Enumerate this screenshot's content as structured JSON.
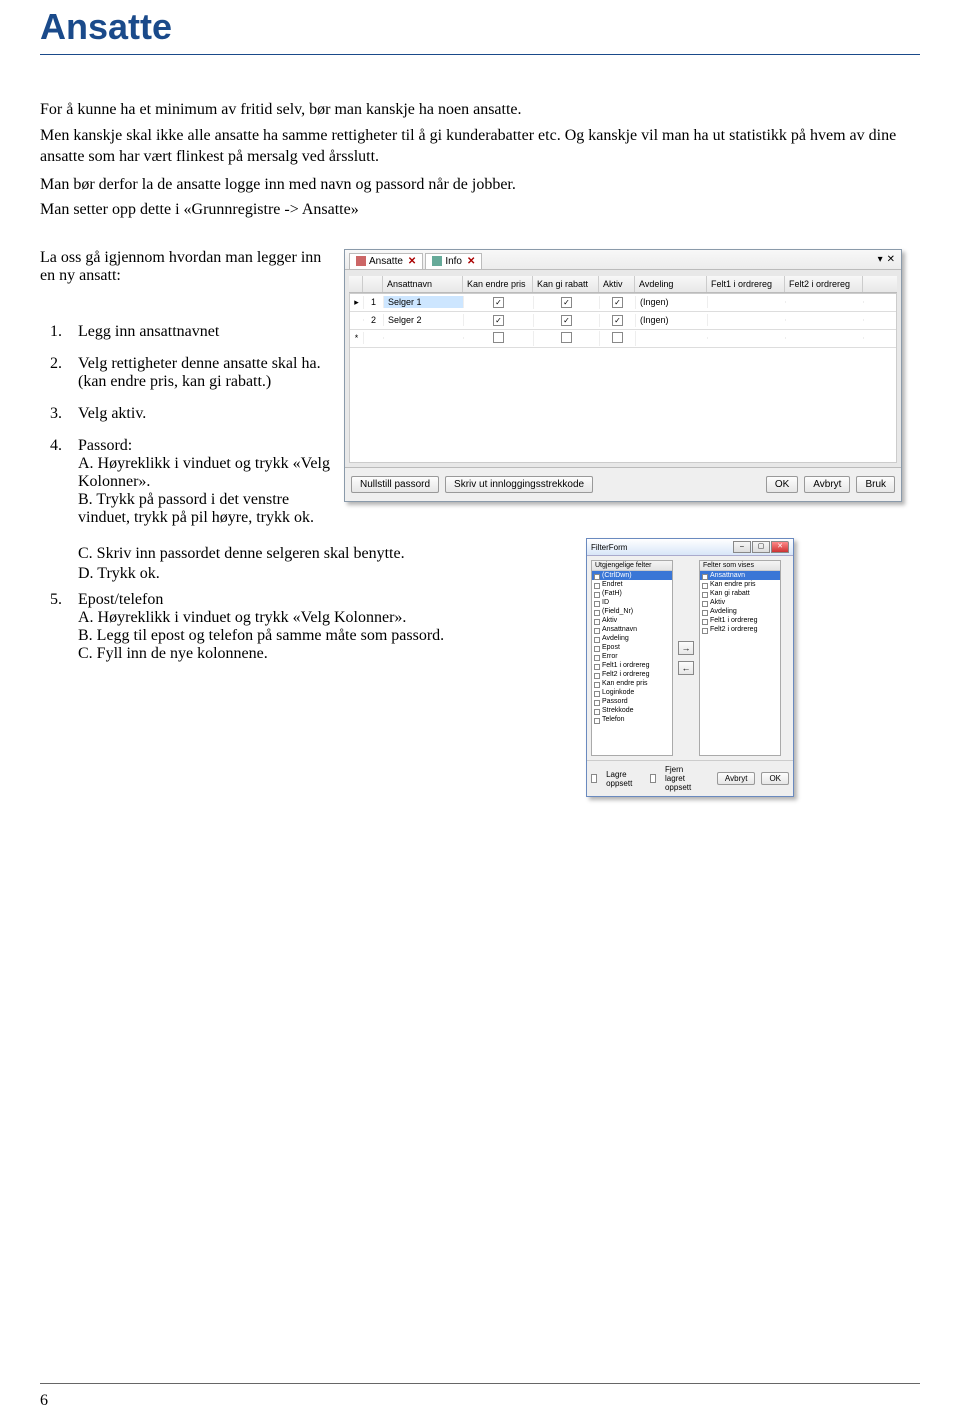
{
  "title": "Ansatte",
  "intro": {
    "p1": "For å kunne ha et minimum av fritid selv, bør man kanskje ha noen ansatte.",
    "p2": "Men kanskje skal ikke alle ansatte ha samme rettigheter til å gi kunderabatter etc. Og kanskje vil man ha ut statistikk på hvem av dine ansatte som har vært flinkest på mersalg ved årsslutt.",
    "p3": "Man bør derfor la de ansatte logge inn med navn og passord  når de jobber.",
    "p4": "Man setter opp dette i «Grunnregistre -> Ansatte»"
  },
  "lead_in": "La oss gå igjennom hvordan man legger inn en ny ansatt:",
  "steps": {
    "s1": "Legg inn ansattnavnet",
    "s2": "Velg rettigheter denne ansatte skal ha. (kan endre pris, kan gi rabatt.)",
    "s3": "Velg aktiv.",
    "s4_title": "Passord:",
    "s4a": "A. Høyreklikk i vinduet og trykk «Velg Kolonner».",
    "s4b": "B. Trykk på passord i det venstre vinduet, trykk på pil høyre, trykk ok.",
    "s4c": "C. Skriv inn passordet denne selgeren skal benytte.",
    "s4d": "D. Trykk ok.",
    "s5_title": "Epost/telefon",
    "s5a": "A. Høyreklikk i vinduet og trykk «Velg Kolonner».",
    "s5b": "B. Legg til epost og telefon på samme måte som passord.",
    "s5c": "C. Fyll inn de nye kolonnene."
  },
  "page_number": "6",
  "appwin": {
    "tab1": "Ansatte",
    "tab2": "Info",
    "columns": {
      "c2": "Ansattnavn",
      "c3": "Kan endre pris",
      "c4": "Kan gi rabatt",
      "c5": "Aktiv",
      "c6": "Avdeling",
      "c7": "Felt1 i ordrereg",
      "c8": "Felt2 i ordrereg"
    },
    "rows": [
      {
        "num": "1",
        "name": "Selger 1",
        "cep": true,
        "cgr": true,
        "cakt": true,
        "avd": "(Ingen)"
      },
      {
        "num": "2",
        "name": "Selger 2",
        "cep": true,
        "cgr": true,
        "cakt": true,
        "avd": "(Ingen)"
      }
    ],
    "buttons": {
      "nullstill": "Nullstill passord",
      "skriv": "Skriv ut innloggingsstrekkode",
      "ok": "OK",
      "avbryt": "Avbryt",
      "bruk": "Bruk"
    }
  },
  "dialog": {
    "title": "FilterForm",
    "left_header": "Utgjengelige felter",
    "right_header": "Felter som vises",
    "left_items": [
      "(CtrlDwn)",
      "Endret",
      "(FatH)",
      "ID",
      "(Field_Nr)",
      "Aktiv",
      "Ansattnavn",
      "Avdeling",
      "Epost",
      "Error",
      "Felt1 i ordrereg",
      "Felt2 i ordrereg",
      "Kan endre pris",
      "Loginkode",
      "Passord",
      "Strekkode",
      "Telefon"
    ],
    "right_items": [
      "Ansattnavn",
      "Kan endre pris",
      "Kan gi rabatt",
      "Aktiv",
      "Avdeling",
      "Felt1 i ordrereg",
      "Felt2 i ordrereg"
    ],
    "lagre": "Lagre oppsett",
    "fjern": "Fjern lagret oppsett",
    "avbryt": "Avbryt",
    "ok": "OK"
  }
}
